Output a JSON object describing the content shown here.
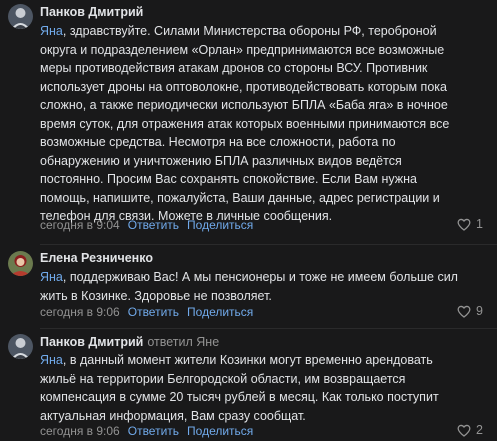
{
  "comments": [
    {
      "author": "Панков Дмитрий",
      "reply_to": "",
      "mention": "Яна",
      "lines": [
        ", здравствуйте. Силами Министерства обороны РФ, тероброной",
        "округа и подразделением «Орлан» предпринимаются все возможные",
        "меры противодействия атакам дронов со стороны ВСУ. Противник",
        "использует дроны на оптоволокне, противодействовать которым пока",
        "сложно, а также периодически используют БПЛА «Баба яга» в ночное",
        "время суток, для отражения атак которых военными принимаются все",
        "возможные средства. Несмотря на все сложности, работа по",
        "обнаружению и уничтожению БПЛА различных видов ведётся",
        "постоянно. Просим Вас сохранять спокойствие. Если Вам нужна",
        "помощь, напишите, пожалуйста, Ваши данные, адрес регистрации и",
        "телефон для связи. Можете в личные сообщения."
      ],
      "time": "сегодня в 9:04",
      "reply_label": "Ответить",
      "share_label": "Поделиться",
      "likes": "1"
    },
    {
      "author": "Елена Резниченко",
      "reply_to": "",
      "mention": "Яна",
      "lines": [
        ", поддерживаю Вас! А мы пенсионеры и тоже не имеем больше сил",
        "жить в Козинке. Здоровье не позволяет."
      ],
      "time": "сегодня в 9:06",
      "reply_label": "Ответить",
      "share_label": "Поделиться",
      "likes": "9"
    },
    {
      "author": "Панков Дмитрий",
      "reply_to": "ответил Яне",
      "mention": "Яна",
      "lines": [
        ", в данный момент жители Козинки могут временно арендовать",
        "жильё на территории Белгородской области, им возвращается",
        "компенсация в сумме 20 тысяч рублей в месяц. Как только поступит",
        "актуальная информация, Вам сразу сообщат."
      ],
      "time": "сегодня в 9:06",
      "reply_label": "Ответить",
      "share_label": "Поделиться",
      "likes": "2"
    }
  ],
  "colors": {
    "background": "#19191a",
    "link": "#71aaeb",
    "secondary": "#939393",
    "text": "#e1e3e6"
  },
  "icons": {
    "like": "heart-icon",
    "avatar": "user-avatar"
  }
}
